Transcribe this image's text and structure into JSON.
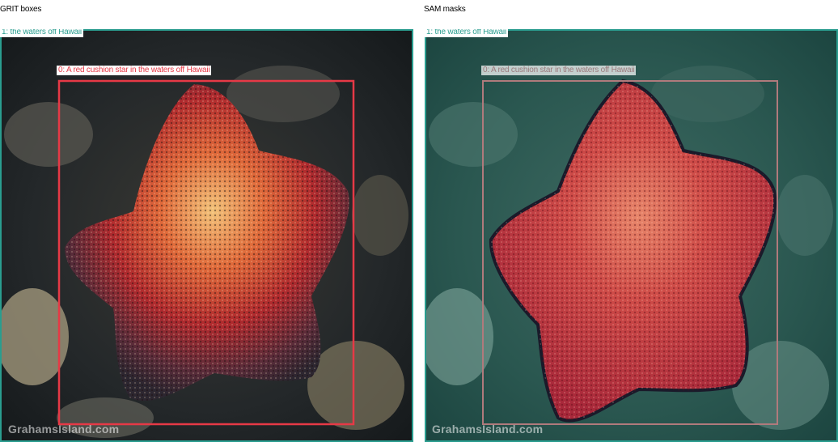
{
  "left_panel": {
    "title": "GRIT boxes",
    "box_water_label": "1: the waters off Hawaii",
    "box_star_label": "0: A red cushion star in the waters off Hawaii",
    "watermark": "GrahamsIsland.com"
  },
  "right_panel": {
    "title": "SAM masks",
    "box_water_label": "1: the waters off Hawaii",
    "box_star_label": "0: A red cushion star in the waters off Hawaii",
    "watermark": "GrahamsIsland.com"
  },
  "colors": {
    "water_box": "#2a9d8f",
    "star_box": "#e63946",
    "star_mask": "#c0283c",
    "water_mask": "#1f6f6a"
  }
}
